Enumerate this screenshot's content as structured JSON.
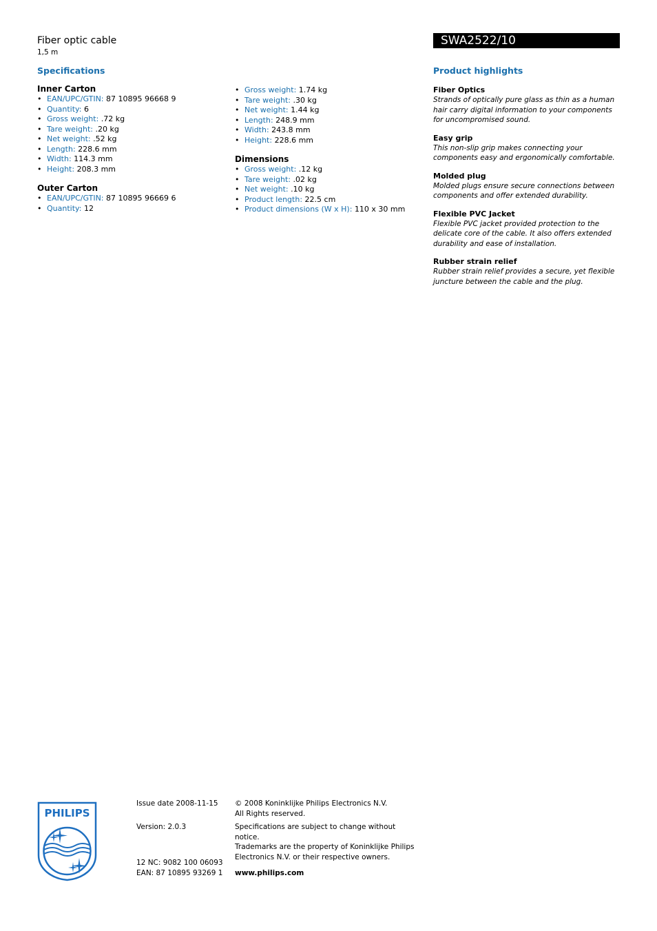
{
  "header": {
    "product_name": "Fiber optic cable",
    "product_variant": "1,5 m",
    "model_number": "SWA2522/10"
  },
  "specifications": {
    "heading": "Specifications",
    "inner_carton": {
      "title": "Inner Carton",
      "items": [
        {
          "label": "EAN/UPC/GTIN:",
          "value": "87 10895 96668 9"
        },
        {
          "label": "Quantity:",
          "value": "6"
        },
        {
          "label": "Gross weight:",
          "value": ".72 kg"
        },
        {
          "label": "Tare weight:",
          "value": ".20 kg"
        },
        {
          "label": "Net weight:",
          "value": ".52 kg"
        },
        {
          "label": "Length:",
          "value": "228.6 mm"
        },
        {
          "label": "Width:",
          "value": "114.3 mm"
        },
        {
          "label": "Height:",
          "value": "208.3 mm"
        }
      ]
    },
    "outer_carton": {
      "title": "Outer Carton",
      "items": [
        {
          "label": "EAN/UPC/GTIN:",
          "value": "87 10895 96669 6"
        },
        {
          "label": "Quantity:",
          "value": "12"
        },
        {
          "label": "Gross weight:",
          "value": "1.74 kg"
        },
        {
          "label": "Tare weight:",
          "value": ".30 kg"
        },
        {
          "label": "Net weight:",
          "value": "1.44 kg"
        },
        {
          "label": "Length:",
          "value": "248.9 mm"
        },
        {
          "label": "Width:",
          "value": "243.8 mm"
        },
        {
          "label": "Height:",
          "value": "228.6 mm"
        }
      ]
    },
    "dimensions": {
      "title": "Dimensions",
      "items": [
        {
          "label": "Gross weight:",
          "value": ".12 kg"
        },
        {
          "label": "Tare weight:",
          "value": ".02 kg"
        },
        {
          "label": "Net weight:",
          "value": ".10 kg"
        },
        {
          "label": "Product length:",
          "value": "22.5 cm"
        },
        {
          "label": "Product dimensions (W x H):",
          "value": "110 x 30 mm"
        }
      ]
    }
  },
  "highlights": {
    "heading": "Product highlights",
    "items": [
      {
        "title": "Fiber Optics",
        "text": "Strands of optically pure glass as thin as a human hair carry digital information to your components for uncompromised sound."
      },
      {
        "title": "Easy grip",
        "text": "This non-slip grip makes connecting your components easy and ergonomically comfortable."
      },
      {
        "title": "Molded plug",
        "text": "Molded plugs ensure secure connections between components and offer extended durability."
      },
      {
        "title": "Flexible PVC Jacket",
        "text": "Flexible PVC jacket provided protection to the delicate core of the cable. It also offers extended durability and ease of installation."
      },
      {
        "title": "Rubber strain relief",
        "text": "Rubber strain relief provides a secure, yet flexible juncture between the cable and the plug."
      }
    ]
  },
  "footer": {
    "logo_text": "PHILIPS",
    "issue_date": "Issue date 2008-11-15",
    "version": "Version: 2.0.3",
    "nc": "12 NC: 9082 100 06093",
    "ean": "EAN: 87 10895 93269 1",
    "copyright_1": "© 2008 Koninklijke Philips Electronics N.V.",
    "copyright_2": "All Rights reserved.",
    "notice_1": "Specifications are subject to change without notice.",
    "notice_2": "Trademarks are the property of Koninklijke Philips",
    "notice_3": "Electronics N.V. or their respective owners.",
    "website": "www.philips.com"
  },
  "colors": {
    "accent_blue": "#1a6fad",
    "logo_blue": "#1e6fc0",
    "model_bar": "#000000"
  }
}
